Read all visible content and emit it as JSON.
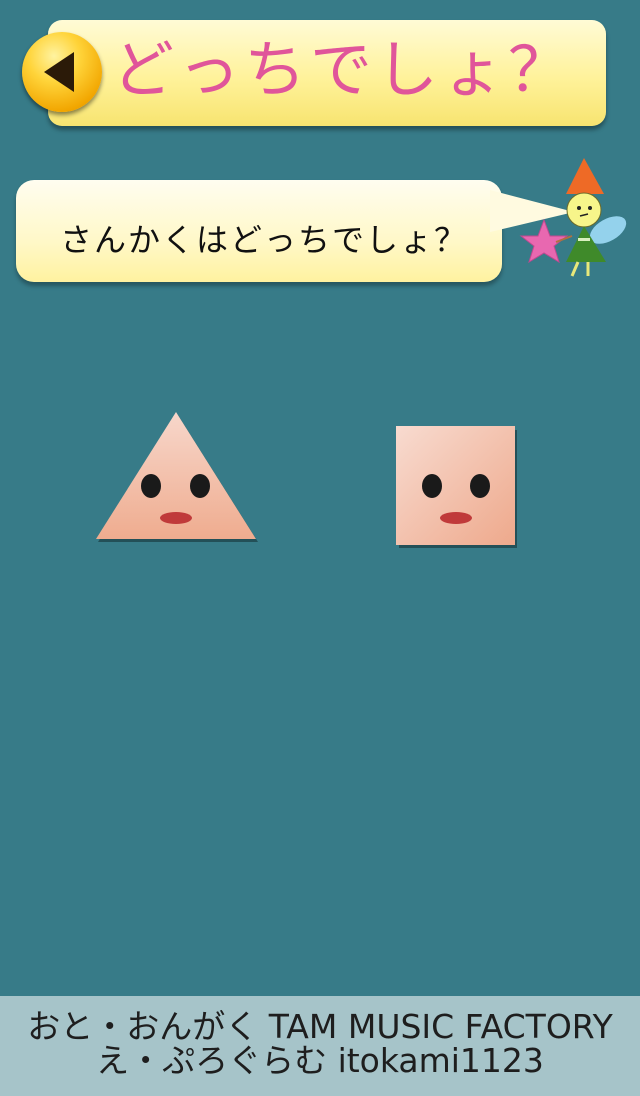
{
  "header": {
    "title": "どっちでしょ？",
    "back_icon": "back-arrow-icon"
  },
  "question": {
    "text": "さんかくはどっちでしょ？"
  },
  "choices": [
    {
      "shape": "triangle",
      "face": "smiling-face"
    },
    {
      "shape": "square",
      "face": "smiling-face"
    }
  ],
  "footer": {
    "line1": "おと・おんがく TAM MUSIC FACTORY",
    "line2": "え・ぷろぐらむ itokami1123"
  },
  "colors": {
    "background": "#377b88",
    "title_text": "#e0559a",
    "banner": "#fff29a",
    "button": "#ffd43a",
    "shape_fill": "#f2c2ad",
    "footer_bg": "#a6c4c9"
  }
}
